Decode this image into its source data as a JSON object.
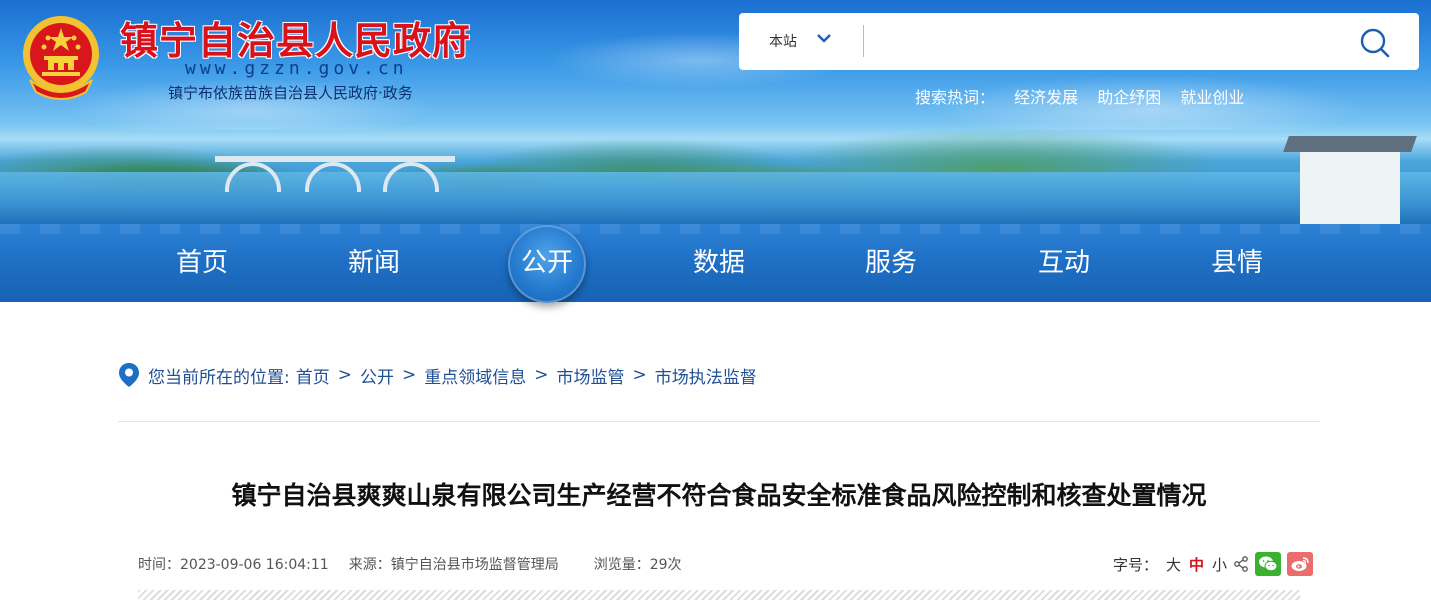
{
  "site": {
    "title": "镇宁自治县人民政府",
    "url": "www.gzzn.gov.cn",
    "subtitle": "镇宁布依族苗族自治县人民政府·政务"
  },
  "search": {
    "scope": "本站",
    "placeholder": "",
    "hot_label": "搜索热词：",
    "hot_words": [
      "经济发展",
      "助企纾困",
      "就业创业"
    ]
  },
  "nav": {
    "items": [
      "首页",
      "新闻",
      "公开",
      "数据",
      "服务",
      "互动",
      "县情"
    ],
    "active": "公开"
  },
  "breadcrumb": {
    "label": "您当前所在的位置:",
    "items": [
      "首页",
      "公开",
      "重点领域信息",
      "市场监管",
      "市场执法监督"
    ],
    "separator": ">"
  },
  "article": {
    "title": "镇宁自治县爽爽山泉有限公司生产经营不符合食品安全标准食品风险控制和核查处置情况",
    "time": "时间：2023-09-06 16:04:11",
    "source": "来源：镇宁自治县市场监督管理局",
    "views": "浏览量：29次"
  },
  "font_size": {
    "label": "字号：",
    "options": [
      "大",
      "中",
      "小"
    ],
    "selected": "中"
  },
  "colors": {
    "title_red": "#d9111b",
    "nav_blue": "#1e6fc4",
    "crumb_blue": "#1f4f94",
    "wechat_green": "#3ab230",
    "weibo_red": "#ea6c6c"
  }
}
